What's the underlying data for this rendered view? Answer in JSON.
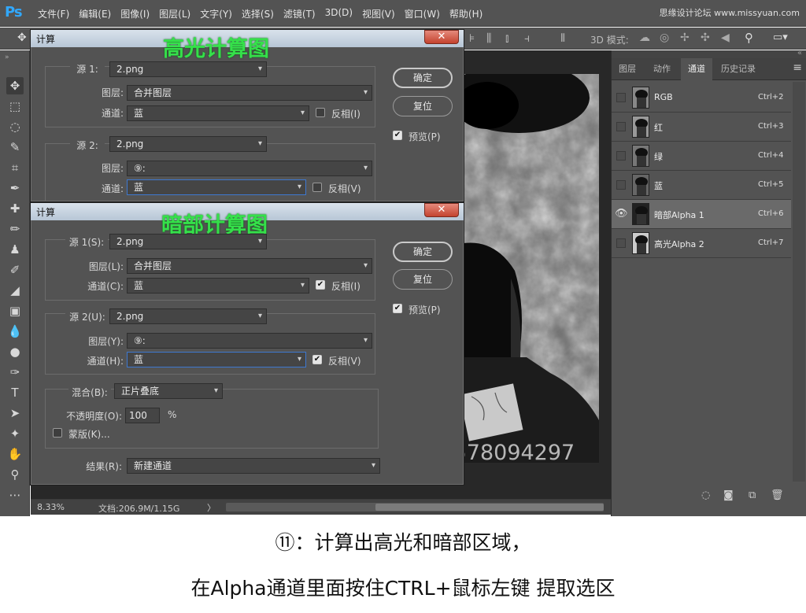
{
  "app": {
    "logo": "Ps",
    "menus": [
      "文件(F)",
      "编辑(E)",
      "图像(I)",
      "图层(L)",
      "文字(Y)",
      "选择(S)",
      "滤镜(T)",
      "3D(D)",
      "视图(V)",
      "窗口(W)",
      "帮助(H)"
    ],
    "watermark_top": "思缘设计论坛 www.missyuan.com",
    "mode3d_label": "3D 模式:"
  },
  "status": {
    "zoom": "8.33%",
    "doc_size": "文档:206.9M/1.15G",
    "arrow": "〉"
  },
  "watermark_center": "接远程调修设计QQ:578094297",
  "channels_panel": {
    "tabs": [
      "图层",
      "动作",
      "通道",
      "历史记录"
    ],
    "active_tab": 2,
    "channels": [
      {
        "name": "RGB",
        "shortcut": "Ctrl+2",
        "visible": false,
        "selected": false
      },
      {
        "name": "红",
        "shortcut": "Ctrl+3",
        "visible": false,
        "selected": false
      },
      {
        "name": "绿",
        "shortcut": "Ctrl+4",
        "visible": false,
        "selected": false
      },
      {
        "name": "蓝",
        "shortcut": "Ctrl+5",
        "visible": false,
        "selected": false
      },
      {
        "name": "暗部Alpha 1",
        "shortcut": "Ctrl+6",
        "visible": true,
        "selected": true
      },
      {
        "name": "高光Alpha 2",
        "shortcut": "Ctrl+7",
        "visible": false,
        "selected": false
      }
    ]
  },
  "dialog1": {
    "title": "计算",
    "overlay_label": "高光计算图",
    "source1_label": "源 1:",
    "source1_value": "2.png",
    "layer1_label": "图层:",
    "layer1_value": "合并图层",
    "channel1_label": "通道:",
    "channel1_value": "蓝",
    "invert1_label": "反相(I)",
    "invert1_checked": false,
    "source2_label": "源 2:",
    "source2_value": "2.png",
    "layer2_label": "图层:",
    "layer2_value": "⑨:",
    "channel2_label": "通道:",
    "channel2_value": "蓝",
    "invert2_label": "反相(V)",
    "invert2_checked": false,
    "ok": "确定",
    "reset": "复位",
    "preview_label": "预览(P)",
    "preview_checked": true
  },
  "dialog2": {
    "title": "计算",
    "overlay_label": "暗部计算图",
    "source1_label": "源 1(S):",
    "source1_value": "2.png",
    "layer1_label": "图层(L):",
    "layer1_value": "合并图层",
    "channel1_label": "通道(C):",
    "channel1_value": "蓝",
    "invert1_label": "反相(I)",
    "invert1_checked": true,
    "source2_label": "源 2(U):",
    "source2_value": "2.png",
    "layer2_label": "图层(Y):",
    "layer2_value": "⑨:",
    "channel2_label": "通道(H):",
    "channel2_value": "蓝",
    "invert2_label": "反相(V)",
    "invert2_checked": true,
    "blend_label": "混合(B):",
    "blend_value": "正片叠底",
    "opacity_label": "不透明度(O):",
    "opacity_value": "100",
    "opacity_unit": "%",
    "mask_label": "蒙版(K)...",
    "mask_checked": false,
    "result_label": "结果(R):",
    "result_value": "新建通道",
    "ok": "确定",
    "reset": "复位",
    "preview_label": "预览(P)",
    "preview_checked": true
  },
  "caption": {
    "line1": "⑪：计算出高光和暗部区域，",
    "line2": "在Alpha通道里面按住CTRL+鼠标左键 提取选区"
  }
}
